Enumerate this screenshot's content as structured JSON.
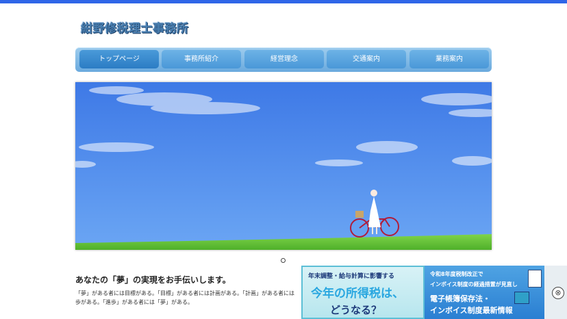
{
  "site": {
    "logo_text": "紺野修税理士事務所",
    "accent": "#2f66e8"
  },
  "nav": {
    "items": [
      {
        "label": "トップページ",
        "active": true
      },
      {
        "label": "事務所紹介"
      },
      {
        "label": "経営理念"
      },
      {
        "label": "交通案内"
      },
      {
        "label": "業務案内"
      }
    ]
  },
  "hero": {
    "image": "blue sky with clouds, grassy hill, woman with bicycle"
  },
  "slider": {
    "indicator_icon": "circle-dot"
  },
  "main": {
    "heading": "あなたの「夢」の実現をお手伝いします。",
    "body_line1": "「夢」がある者には目標がある。「目標」がある者には計画がある。「計画」がある者には",
    "body_line2": "歩がある。「進歩」がある者には「夢」がある。"
  },
  "ad": {
    "left_line1": "年末調整・給与計算に影響する",
    "left_line2": "今年の所得税は、",
    "left_line3": "どうなる？",
    "right_line1": "令和8年度税制改正で",
    "right_line2": "インボイス制度の経過措置が見直し",
    "right_line3": "電子帳簿保存法・",
    "right_line4": "インボイス制度最新情報",
    "close_icon": "⊗"
  }
}
